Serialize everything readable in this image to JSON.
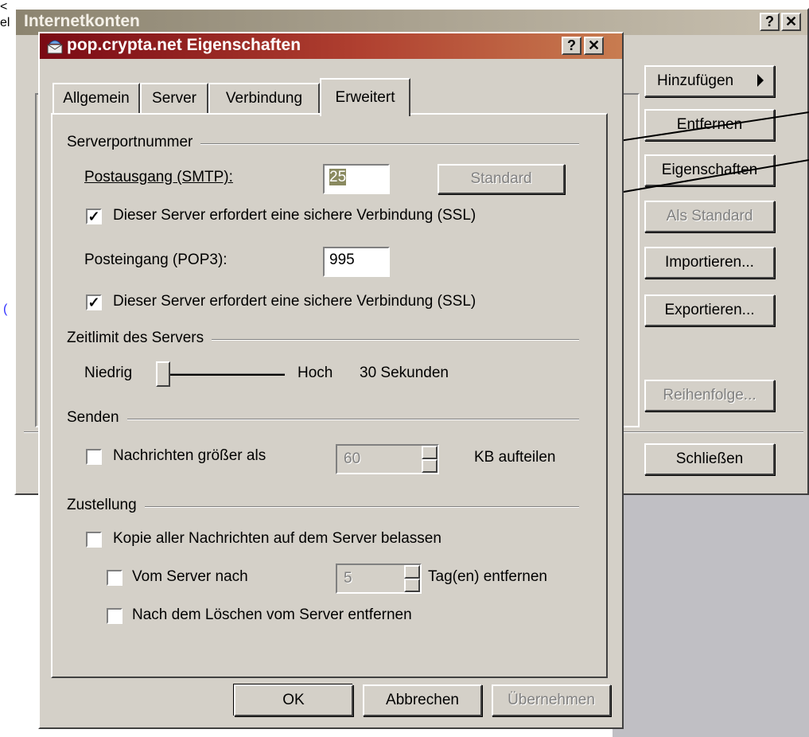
{
  "bg_window": {
    "title": "Internetkonten",
    "help_btn": "?",
    "close_btn": "✕",
    "buttons": {
      "add": "Hinzufügen",
      "remove": "Entfernen",
      "properties": "Eigenschaften",
      "default": "Als Standard",
      "import": "Importieren...",
      "export": "Exportieren...",
      "order": "Reihenfolge...",
      "close": "Schließen"
    }
  },
  "dialog": {
    "title": "pop.crypta.net Eigenschaften",
    "help_btn": "?",
    "close_btn": "✕",
    "tabs": [
      "Allgemein",
      "Server",
      "Verbindung",
      "Erweitert"
    ],
    "active_tab": "Erweitert",
    "port_group": {
      "label": "Serverportnummer",
      "smtp_label": "Postausgang (SMTP):",
      "smtp_value": "25",
      "standard_button": "Standard",
      "smtp_ssl_label": "Dieser Server erfordert eine sichere Verbindung (SSL)",
      "smtp_ssl_checked": true,
      "pop3_label": "Posteingang (POP3):",
      "pop3_value": "995",
      "pop3_ssl_label": "Dieser Server erfordert eine sichere Verbindung (SSL)",
      "pop3_ssl_checked": true
    },
    "timeout_group": {
      "label": "Zeitlimit des Servers",
      "low": "Niedrig",
      "high": "Hoch",
      "value_text": "30 Sekunden",
      "slider_level": 0
    },
    "send_group": {
      "label": "Senden",
      "split_label": "Nachrichten größer als",
      "split_checked": false,
      "split_value": "60",
      "split_unit": "KB aufteilen"
    },
    "delivery_group": {
      "label": "Zustellung",
      "keep_label": "Kopie aller Nachrichten auf dem Server belassen",
      "keep_checked": false,
      "remove_after_label": "Vom Server nach",
      "remove_after_checked": false,
      "remove_after_value": "5",
      "remove_after_unit": "Tag(en) entfernen",
      "remove_deleted_label": "Nach dem Löschen vom Server entfernen",
      "remove_deleted_checked": false
    },
    "buttons": {
      "ok": "OK",
      "cancel": "Abbrechen",
      "apply": "Übernehmen"
    }
  },
  "colors": {
    "face": "#d4d0c8",
    "title_active": "#0a246a",
    "title_dialog_start": "#7a0a14",
    "title_dialog_end": "#c87c50",
    "title_inactive": "#a09a88"
  }
}
